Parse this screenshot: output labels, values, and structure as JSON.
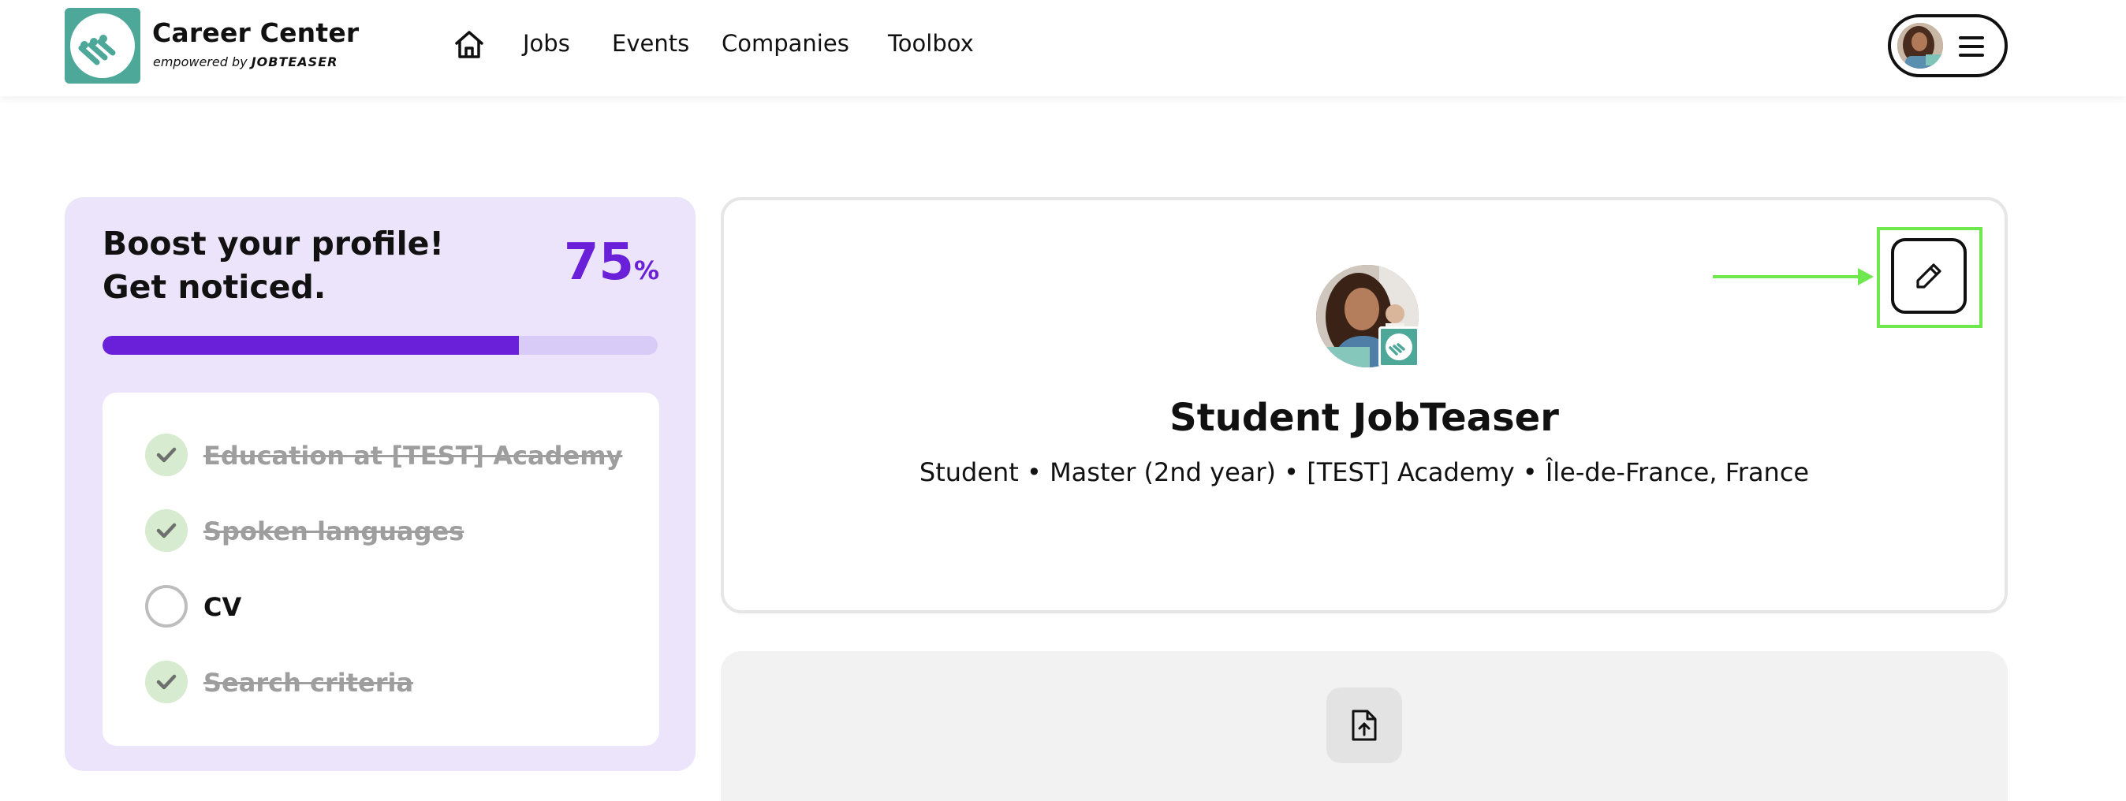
{
  "header": {
    "brand_title": "Career Center",
    "brand_sub_prefix": "empowered by",
    "brand_sub_name": "JOBTEASER",
    "logo_color": "#4ea89a",
    "home_icon": "home-icon",
    "nav": [
      {
        "label": "Jobs"
      },
      {
        "label": "Events"
      },
      {
        "label": "Companies"
      },
      {
        "label": "Toolbox"
      }
    ],
    "menu_icon": "hamburger-icon"
  },
  "boost": {
    "title": "Boost your profile! Get noticed.",
    "percent_value": "75",
    "percent_unit": "%",
    "progress_fraction": 0.75,
    "accent_color": "#6a1fd8",
    "items": [
      {
        "label": "Education at [TEST] Academy",
        "done": true
      },
      {
        "label": "Spoken languages",
        "done": true
      },
      {
        "label": "CV",
        "done": false
      },
      {
        "label": "Search criteria",
        "done": true
      }
    ]
  },
  "profile": {
    "name": "Student JobTeaser",
    "meta": "Student • Master (2nd year) • [TEST] Academy • Île-de-France, France",
    "edit_icon": "pencil-icon",
    "highlight_color": "#6ee84c"
  },
  "upload": {
    "icon": "file-upload-icon"
  }
}
